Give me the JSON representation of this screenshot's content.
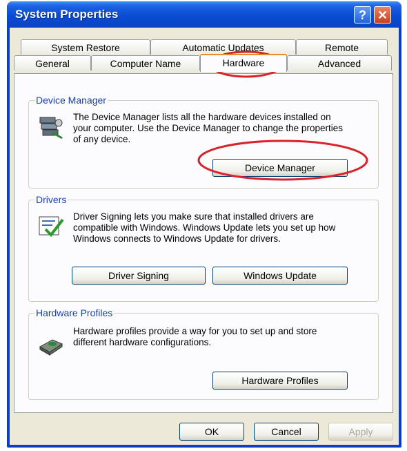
{
  "window": {
    "title": "System Properties",
    "help_glyph": "?",
    "close_glyph": "✕"
  },
  "tabs_row1": [
    "System Restore",
    "Automatic Updates",
    "Remote"
  ],
  "tabs_row2": [
    "General",
    "Computer Name",
    "Hardware",
    "Advanced"
  ],
  "active_tab": "Hardware",
  "device_manager": {
    "label": "Device Manager",
    "description": "The Device Manager lists all the hardware devices installed on your computer. Use the Device Manager to change the properties of any device.",
    "button": "Device Manager",
    "icon": "device-manager-icon"
  },
  "drivers": {
    "label": "Drivers",
    "description": "Driver Signing lets you make sure that installed drivers are compatible with Windows. Windows Update lets you set up how Windows connects to Windows Update for drivers.",
    "button_signing": "Driver Signing",
    "button_update": "Windows Update",
    "icon": "driver-checklist-icon"
  },
  "hardware_profiles": {
    "label": "Hardware Profiles",
    "description": "Hardware profiles provide a way for you to set up and store different hardware configurations.",
    "button": "Hardware Profiles",
    "icon": "hardware-profile-icon"
  },
  "footer": {
    "ok": "OK",
    "cancel": "Cancel",
    "apply": "Apply"
  },
  "colors": {
    "titlebar": "#0a4bd6",
    "dialog_bg": "#ece9d8",
    "group_label": "#1b3fa0",
    "highlight_circle": "#d8232a"
  }
}
